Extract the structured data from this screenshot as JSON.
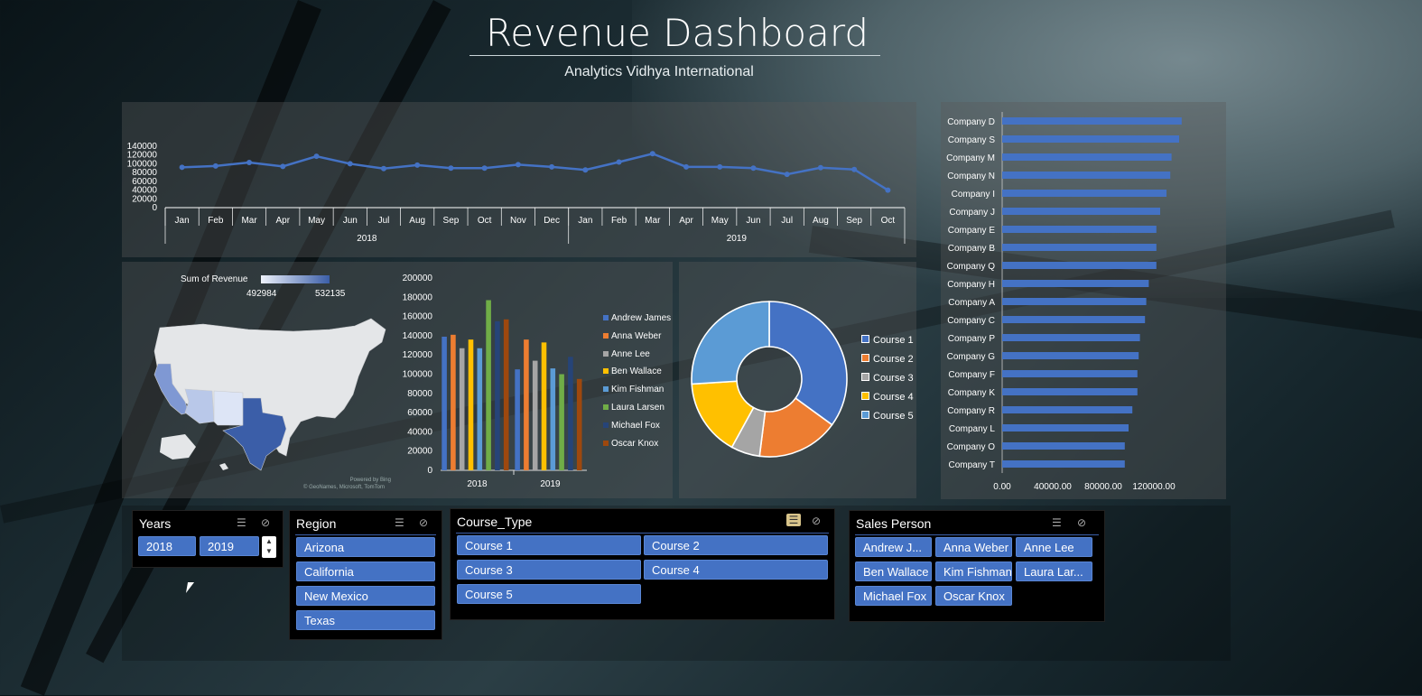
{
  "header": {
    "title": "Revenue Dashboard",
    "subtitle": "Analytics Vidhya International"
  },
  "chart_data": [
    {
      "id": "monthly-line",
      "type": "line",
      "title": "",
      "x": [
        "Jan",
        "Feb",
        "Mar",
        "Apr",
        "May",
        "Jun",
        "Jul",
        "Aug",
        "Sep",
        "Oct",
        "Nov",
        "Dec",
        "Jan",
        "Feb",
        "Mar",
        "Apr",
        "May",
        "Jun",
        "Jul",
        "Aug",
        "Sep",
        "Oct"
      ],
      "x_groups": [
        {
          "label": "2018",
          "span": 12
        },
        {
          "label": "2019",
          "span": 10
        }
      ],
      "series": [
        {
          "values": [
            92000,
            95000,
            103000,
            94000,
            117000,
            100000,
            89000,
            97000,
            90000,
            90000,
            98000,
            93000,
            86000,
            104000,
            123000,
            93000,
            93000,
            90000,
            76000,
            91000,
            87000,
            40000
          ]
        }
      ],
      "yticks": [
        "140000",
        "120000",
        "100000",
        "80000",
        "60000",
        "40000",
        "20000",
        "0"
      ],
      "ylim": [
        0,
        140000
      ],
      "color": "#4472c4"
    },
    {
      "id": "map",
      "type": "heatmap",
      "title": "Sum of Revenue",
      "legend_min": "492984",
      "legend_max": "532135",
      "regions": [
        {
          "name": "Texas",
          "level": 1.0
        },
        {
          "name": "California",
          "level": 0.55
        },
        {
          "name": "New Mexico",
          "level": 0.15
        },
        {
          "name": "Arizona",
          "level": 0.3
        }
      ],
      "attribution_1": "Powered by Bing",
      "attribution_2": "© GeoNames, Microsoft, TomTom"
    },
    {
      "id": "salesperson-bars",
      "type": "bar",
      "categories": [
        "2018",
        "2019"
      ],
      "yticks": [
        "200000",
        "180000",
        "160000",
        "140000",
        "120000",
        "100000",
        "80000",
        "60000",
        "40000",
        "20000",
        "0"
      ],
      "ylim": [
        0,
        200000
      ],
      "series": [
        {
          "name": "Andrew James",
          "color": "#4472c4",
          "values": [
            139000,
            105000
          ]
        },
        {
          "name": "Anna Weber",
          "color": "#ed7d31",
          "values": [
            141000,
            136000
          ]
        },
        {
          "name": "Anne Lee",
          "color": "#a5a5a5",
          "values": [
            127000,
            114000
          ]
        },
        {
          "name": "Ben Wallace",
          "color": "#ffc000",
          "values": [
            136000,
            133000
          ]
        },
        {
          "name": "Kim Fishman",
          "color": "#5b9bd5",
          "values": [
            127000,
            106000
          ]
        },
        {
          "name": "Laura Larsen",
          "color": "#70ad47",
          "values": [
            177000,
            100000
          ]
        },
        {
          "name": "Michael Fox",
          "color": "#264478",
          "values": [
            155000,
            118000
          ]
        },
        {
          "name": "Oscar Knox",
          "color": "#9e480e",
          "values": [
            157000,
            95000
          ]
        }
      ]
    },
    {
      "id": "course-donut",
      "type": "pie",
      "series": [
        {
          "name": "Course 1",
          "color": "#4472c4",
          "value": 35
        },
        {
          "name": "Course 2",
          "color": "#ed7d31",
          "value": 17
        },
        {
          "name": "Course 3",
          "color": "#a5a5a5",
          "value": 6
        },
        {
          "name": "Course 4",
          "color": "#ffc000",
          "value": 16
        },
        {
          "name": "Course 5",
          "color": "#5b9bd5",
          "value": 26
        }
      ]
    },
    {
      "id": "company-bars",
      "type": "bar",
      "orientation": "horizontal",
      "categories": [
        "Company D",
        "Company S",
        "Company M",
        "Company N",
        "Company I",
        "Company J",
        "Company E",
        "Company B",
        "Company Q",
        "Company H",
        "Company A",
        "Company C",
        "Company P",
        "Company G",
        "Company F",
        "Company K",
        "Company R",
        "Company L",
        "Company O",
        "Company T"
      ],
      "values": [
        142000,
        140000,
        134000,
        133000,
        130000,
        125000,
        122000,
        122000,
        122000,
        116000,
        114000,
        113000,
        109000,
        108000,
        107000,
        107000,
        103000,
        100000,
        97000,
        97000
      ],
      "xticks": [
        "0.00",
        "40000.00",
        "80000.00",
        "120000.00"
      ],
      "xlim": [
        0,
        160000
      ],
      "color": "#4472c4"
    }
  ],
  "slicers": {
    "years": {
      "title": "Years",
      "items": [
        "2018",
        "2019"
      ]
    },
    "region": {
      "title": "Region",
      "items": [
        "Arizona",
        "California",
        "New Mexico",
        "Texas"
      ]
    },
    "course_type": {
      "title": "Course_Type",
      "items": [
        "Course 1",
        "Course 2",
        "Course 3",
        "Course 4",
        "Course 5"
      ]
    },
    "sales_person": {
      "title": "Sales Person",
      "items": [
        "Andrew J...",
        "Anna Weber",
        "Anne Lee",
        "Ben Wallace",
        "Kim Fishman",
        "Laura Lar...",
        "Michael Fox",
        "Oscar Knox"
      ]
    }
  },
  "icons": {
    "multiselect": "multi-select-icon",
    "clear_filter": "clear-filter-icon"
  }
}
